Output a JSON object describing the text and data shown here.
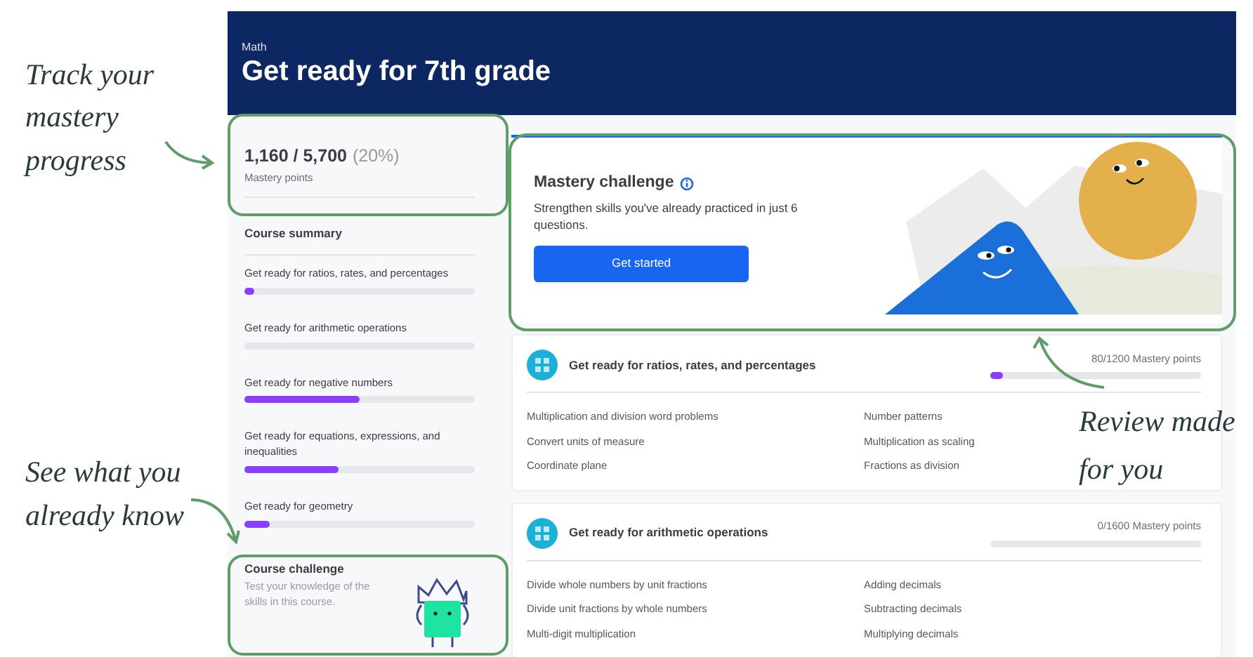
{
  "annotations": [
    {
      "text": "Track your mastery progress"
    },
    {
      "text": "See what you already know"
    },
    {
      "text": "Review made for you"
    }
  ],
  "header": {
    "subject": "Math",
    "title": "Get ready for 7th  grade"
  },
  "sidebar": {
    "points": "1,160 / 5,700",
    "percent": "(20%)",
    "points_label": "Mastery points",
    "summary_title": "Course summary",
    "units": [
      {
        "name": "Get ready for ratios, rates, and percentages",
        "level": 0.04
      },
      {
        "name": "Get ready for arithmetic operations",
        "level": 0
      },
      {
        "name": "Get ready for negative numbers",
        "level": 0.5
      },
      {
        "name": "Get ready for equations, expressions, and inequalities",
        "level": 0.41
      },
      {
        "name": "Get ready for geometry",
        "level": 0.11
      }
    ],
    "challenge": {
      "title": "Course challenge",
      "text": "Test your knowledge of the skills in this course."
    }
  },
  "mastery_challenge": {
    "title": "Mastery challenge",
    "text": "Strengthen skills you've already practiced in just 6 questions.",
    "button": "Get started"
  },
  "units": [
    {
      "title": "Get ready for ratios, rates, and percentages",
      "points": "80/1200 Mastery points",
      "level": 0.06,
      "skills": [
        "Multiplication and division word problems",
        "Number patterns",
        "Convert units of measure",
        "Multiplication as scaling",
        "Coordinate plane",
        "Fractions as division"
      ]
    },
    {
      "title": "Get ready for arithmetic operations",
      "points": "0/1600 Mastery points",
      "level": 0,
      "skills": [
        "Divide whole numbers by unit fractions",
        "Adding decimals",
        "Divide unit fractions by whole numbers",
        "Subtracting decimals",
        "Multi-digit multiplication",
        "Multiplying decimals"
      ]
    }
  ]
}
